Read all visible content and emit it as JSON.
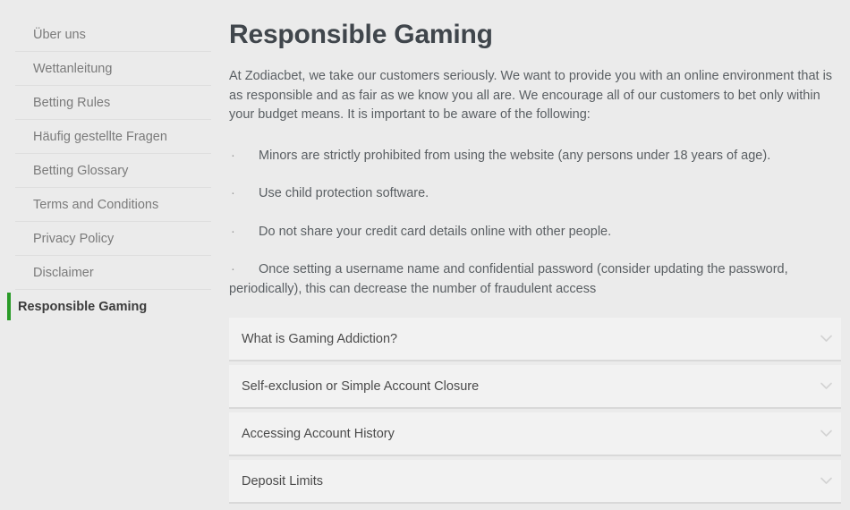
{
  "theme": {
    "page_background": "#ebebeb",
    "panel_background": "#f2f2f2",
    "accent_green": "#2a9b28",
    "title_color": "#40464c",
    "body_text_color": "#5a5f63",
    "sidebar_text_color": "#7b7b7b",
    "divider_color": "#dedede",
    "chevron_color": "#d3d3d3"
  },
  "sidebar": {
    "items": [
      {
        "label": "Über uns",
        "active": false
      },
      {
        "label": "Wettanleitung",
        "active": false
      },
      {
        "label": "Betting Rules",
        "active": false
      },
      {
        "label": "Häufig gestellte Fragen",
        "active": false
      },
      {
        "label": "Betting Glossary",
        "active": false
      },
      {
        "label": "Terms and Conditions",
        "active": false
      },
      {
        "label": "Privacy Policy",
        "active": false
      },
      {
        "label": "Disclaimer",
        "active": false
      },
      {
        "label": "Responsible Gaming",
        "active": true
      }
    ]
  },
  "main": {
    "title": "Responsible Gaming",
    "intro": "At Zodiacbet, we take our customers seriously. We want to provide you with an online environment that is as responsible and as fair as we know you all are. We encourage all of our customers to bet only within your budget means. It is important to be aware of the following:",
    "bullet_marker": "·",
    "bullets": [
      "Minors are strictly prohibited from using the website (any persons under 18 years of age).",
      "Use child protection software.",
      "Do not share your credit card details online with other people.",
      "Once setting a username name and confidential password (consider updating the password, periodically), this can decrease the number of fraudulent access"
    ],
    "accordion": {
      "icon": "chevron-down-icon",
      "items": [
        {
          "label": "What is Gaming Addiction?",
          "expanded": false
        },
        {
          "label": "Self-exclusion or Simple Account Closure",
          "expanded": false
        },
        {
          "label": "Accessing Account History",
          "expanded": false
        },
        {
          "label": "Deposit Limits",
          "expanded": false
        }
      ]
    }
  }
}
